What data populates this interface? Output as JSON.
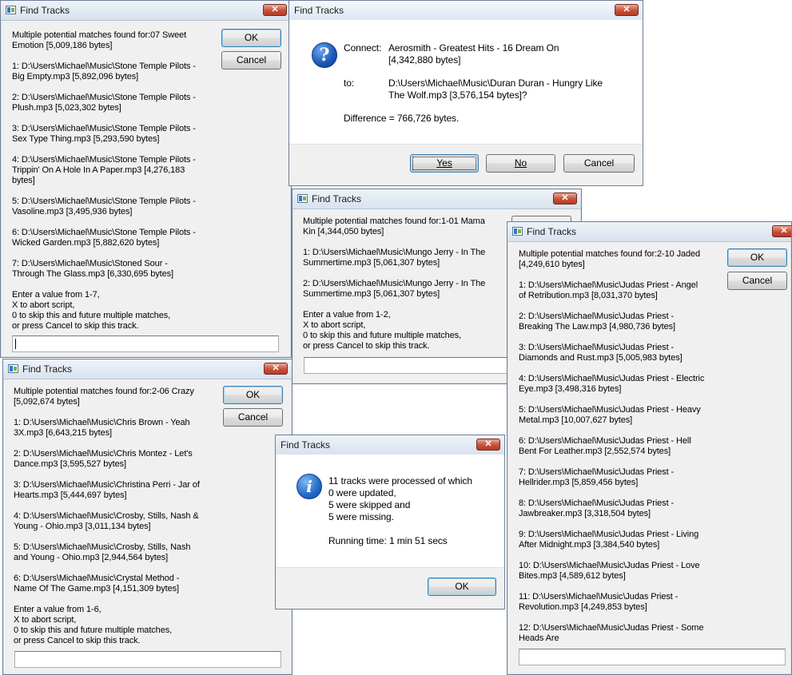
{
  "window_title": "Find Tracks",
  "close_glyph": "✕",
  "dlg1": {
    "message": "Multiple potential matches found for:07 Sweet\nEmotion [5,009,186 bytes]\n\n1: D:\\Users\\Michael\\Music\\Stone Temple Pilots -\nBig Empty.mp3 [5,892,096 bytes]\n\n2: D:\\Users\\Michael\\Music\\Stone Temple Pilots -\nPlush.mp3 [5,023,302 bytes]\n\n3: D:\\Users\\Michael\\Music\\Stone Temple Pilots -\nSex Type Thing.mp3 [5,293,590 bytes]\n\n4: D:\\Users\\Michael\\Music\\Stone Temple Pilots -\nTrippin' On A Hole In A Paper.mp3 [4,276,183\nbytes]\n\n5: D:\\Users\\Michael\\Music\\Stone Temple Pilots -\nVasoline.mp3 [3,495,936 bytes]\n\n6: D:\\Users\\Michael\\Music\\Stone Temple Pilots -\nWicked Garden.mp3 [5,882,620 bytes]\n\n7: D:\\Users\\Michael\\Music\\Stoned Sour -\nThrough The Glass.mp3 [6,330,695 bytes]\n\nEnter a value from 1-7,\nX to abort script,\n0 to skip this and future multiple matches,\nor press Cancel to skip this track.",
    "ok": "OK",
    "cancel": "Cancel",
    "input_value": ""
  },
  "dlg2": {
    "message": "Multiple potential matches found for:2-06 Crazy\n[5,092,674 bytes]\n\n1: D:\\Users\\Michael\\Music\\Chris Brown - Yeah\n3X.mp3 [6,643,215 bytes]\n\n2: D:\\Users\\Michael\\Music\\Chris Montez - Let's\nDance.mp3 [3,595,527 bytes]\n\n3: D:\\Users\\Michael\\Music\\Christina Perri - Jar of\nHearts.mp3 [5,444,697 bytes]\n\n4: D:\\Users\\Michael\\Music\\Crosby, Stills, Nash &\nYoung - Ohio.mp3 [3,011,134 bytes]\n\n5: D:\\Users\\Michael\\Music\\Crosby, Stills, Nash\nand Young - Ohio.mp3 [2,944,564 bytes]\n\n6: D:\\Users\\Michael\\Music\\Crystal Method -\nName Of The Game.mp3 [4,151,309 bytes]\n\nEnter a value from 1-6,\nX to abort script,\n0 to skip this and future multiple matches,\nor press Cancel to skip this track.",
    "ok": "OK",
    "cancel": "Cancel",
    "input_value": ""
  },
  "dlg3": {
    "connect_label": "Connect:",
    "connect_value": "Aerosmith - Greatest Hits - 16 Dream On\n[4,342,880 bytes]",
    "to_label": "to:",
    "to_value": "D:\\Users\\Michael\\Music\\Duran Duran - Hungry Like\nThe Wolf.mp3 [3,576,154 bytes]?",
    "difference": "Difference = 766,726 bytes.",
    "yes": "Yes",
    "no": "No",
    "cancel": "Cancel"
  },
  "dlg4": {
    "message": "Multiple potential matches found for:1-01 Mama\nKin [4,344,050 bytes]\n\n1: D:\\Users\\Michael\\Music\\Mungo Jerry - In The\nSummertime.mp3 [5,061,307 bytes]\n\n2: D:\\Users\\Michael\\Music\\Mungo Jerry - In The\nSummertime.mp3 [5,061,307 bytes]\n\nEnter a value from 1-2,\nX to abort script,\n0 to skip this and future multiple matches,\nor press Cancel to skip this track.",
    "input_value": ""
  },
  "dlg5": {
    "message": "Multiple potential matches found for:2-10 Jaded\n[4,249,610 bytes]\n\n1: D:\\Users\\Michael\\Music\\Judas Priest - Angel\nof Retribution.mp3 [8,031,370 bytes]\n\n2: D:\\Users\\Michael\\Music\\Judas Priest -\nBreaking The Law.mp3 [4,980,736 bytes]\n\n3: D:\\Users\\Michael\\Music\\Judas Priest -\nDiamonds and Rust.mp3 [5,005,983 bytes]\n\n4: D:\\Users\\Michael\\Music\\Judas Priest - Electric\nEye.mp3 [3,498,316 bytes]\n\n5: D:\\Users\\Michael\\Music\\Judas Priest - Heavy\nMetal.mp3 [10,007,627 bytes]\n\n6: D:\\Users\\Michael\\Music\\Judas Priest - Hell\nBent For Leather.mp3 [2,552,574 bytes]\n\n7: D:\\Users\\Michael\\Music\\Judas Priest -\nHellrider.mp3 [5,859,456 bytes]\n\n8: D:\\Users\\Michael\\Music\\Judas Priest -\nJawbreaker.mp3 [3,318,504 bytes]\n\n9: D:\\Users\\Michael\\Music\\Judas Priest - Living\nAfter Midnight.mp3 [3,384,540 bytes]\n\n10: D:\\Users\\Michael\\Music\\Judas Priest - Love\nBites.mp3 [4,589,612 bytes]\n\n11: D:\\Users\\Michael\\Music\\Judas Priest -\nRevolution.mp3 [4,249,853 bytes]\n\n12: D:\\Users\\Michael\\Music\\Judas Priest - Some\nHeads Are",
    "ok": "OK",
    "cancel": "Cancel",
    "input_value": ""
  },
  "dlg6": {
    "message": "11 tracks were processed of which\n0 were updated,\n5 were skipped and\n5 were missing.\n\nRunning time: 1 min 51 secs",
    "ok": "OK"
  },
  "icons": {
    "question": "?",
    "info": "i"
  },
  "colors": {
    "close_button": "#c7503a",
    "icon_blue": "#1a56b8",
    "dialog_background": "#f0f0f0"
  }
}
